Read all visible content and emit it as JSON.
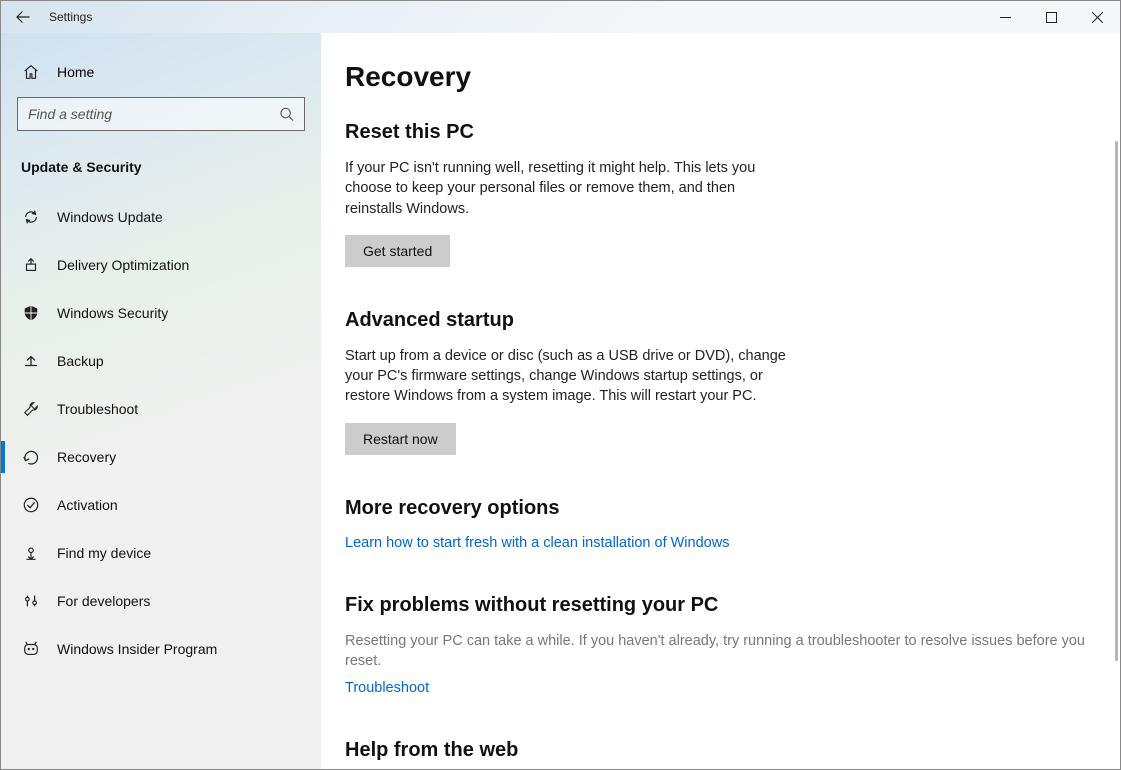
{
  "titlebar": {
    "app_name": "Settings"
  },
  "sidebar": {
    "home_label": "Home",
    "search_placeholder": "Find a setting",
    "category": "Update & Security",
    "items": [
      {
        "icon": "sync-icon",
        "label": "Windows Update"
      },
      {
        "icon": "delivery-icon",
        "label": "Delivery Optimization"
      },
      {
        "icon": "shield-icon",
        "label": "Windows Security"
      },
      {
        "icon": "backup-icon",
        "label": "Backup"
      },
      {
        "icon": "wrench-icon",
        "label": "Troubleshoot"
      },
      {
        "icon": "recovery-icon",
        "label": "Recovery",
        "active": true
      },
      {
        "icon": "check-icon",
        "label": "Activation"
      },
      {
        "icon": "locate-icon",
        "label": "Find my device"
      },
      {
        "icon": "dev-icon",
        "label": "For developers"
      },
      {
        "icon": "insider-icon",
        "label": "Windows Insider Program"
      }
    ]
  },
  "main": {
    "title": "Recovery",
    "sections": {
      "reset": {
        "heading": "Reset this PC",
        "desc": "If your PC isn't running well, resetting it might help. This lets you choose to keep your personal files or remove them, and then reinstalls Windows.",
        "button": "Get started"
      },
      "advanced": {
        "heading": "Advanced startup",
        "desc": "Start up from a device or disc (such as a USB drive or DVD), change your PC's firmware settings, change Windows startup settings, or restore Windows from a system image. This will restart your PC.",
        "button": "Restart now"
      },
      "more": {
        "heading": "More recovery options",
        "link": "Learn how to start fresh with a clean installation of Windows"
      },
      "fix": {
        "heading": "Fix problems without resetting your PC",
        "desc": "Resetting your PC can take a while. If you haven't already, try running a troubleshooter to resolve issues before you reset.",
        "link": "Troubleshoot"
      },
      "help": {
        "heading": "Help from the web"
      }
    }
  }
}
